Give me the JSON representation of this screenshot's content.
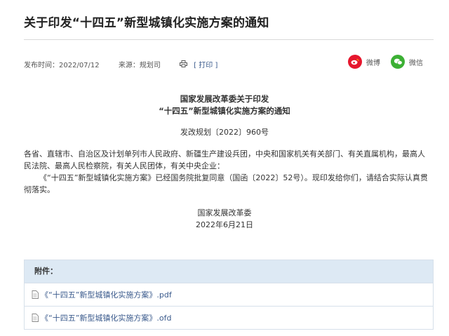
{
  "article": {
    "title": "关于印发“十四五”新型城镇化实施方案的通知",
    "meta": {
      "publish_time": "发布时间：2022/07/12",
      "source": "来源：规划司",
      "print_label": "[ 打印 ]"
    },
    "share": {
      "weibo_label": "微博",
      "wechat_label": "微信"
    },
    "doc": {
      "issuer_line": "国家发展改革委关于印发",
      "title_line": "“十四五”新型城镇化实施方案的通知",
      "doc_number": "发改规划〔2022〕960号",
      "addressees": "各省、直辖市、自治区及计划单列市人民政府、新疆生产建设兵团，中央和国家机关有关部门、有关直属机构，最高人民法院、最高人民检察院，有关人民团体，有关中央企业：",
      "body": "《“十四五”新型城镇化实施方案》已经国务院批复同意（国函〔2022〕52号）。现印发给你们，请结合实际认真贯彻落实。",
      "signer": "国家发展改革委",
      "date": "2022年6月21日"
    },
    "attachments": {
      "header": "附件：",
      "files": [
        "《“十四五”新型城镇化实施方案》.pdf",
        "《“十四五”新型城镇化实施方案》.ofd"
      ]
    },
    "colors": {
      "weibo": "#e6162d",
      "wechat": "#3cb034",
      "attachment_header_bg": "#dde9f4",
      "link": "#3a5a8c"
    }
  }
}
